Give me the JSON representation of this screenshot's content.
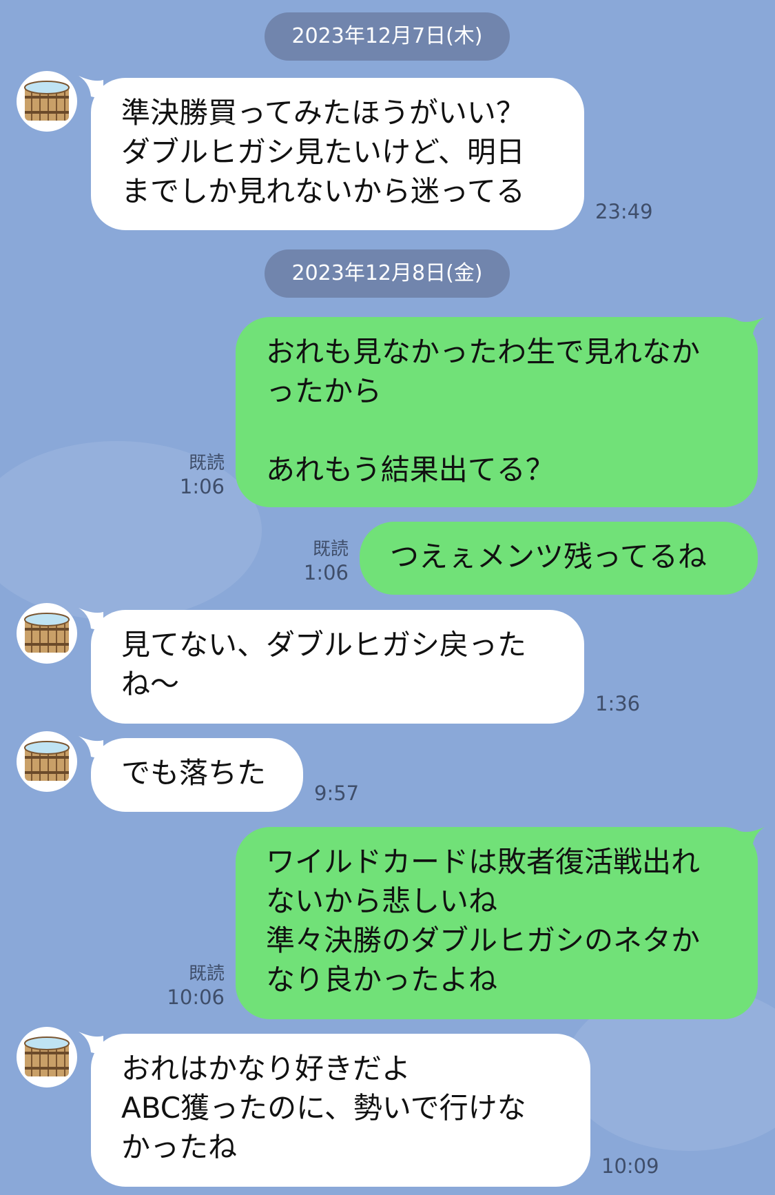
{
  "dates": [
    "2023年12月7日(木)",
    "2023年12月8日(金)"
  ],
  "messages": [
    {
      "side": "in",
      "text": "準決勝買ってみたほうがいい？\nダブルヒガシ見たいけど、明日\nまでしか見れないから迷ってる",
      "time": "23:49"
    },
    {
      "side": "out",
      "text": "おれも見なかったわ生で見れなか\nったから\n\nあれもう結果出てる？",
      "read": "既読",
      "time": "1:06"
    },
    {
      "side": "out",
      "text": "つえぇメンツ残ってるね",
      "read": "既読",
      "time": "1:06"
    },
    {
      "side": "in",
      "text": "見てない、ダブルヒガシ戻った\nね〜",
      "time": "1:36"
    },
    {
      "side": "in",
      "text": "でも落ちた",
      "time": "9:57"
    },
    {
      "side": "out",
      "text": "ワイルドカードは敗者復活戦出れ\nないから悲しいね\n準々決勝のダブルヒガシのネタか\nなり良かったよね",
      "read": "既読",
      "time": "10:06"
    },
    {
      "side": "in",
      "text": "おれはかなり好きだよ\nABC獲ったのに、勢いで行けな\nかったね",
      "time": "10:09"
    }
  ],
  "avatar_icon": "wooden-tub-icon",
  "colors": {
    "background": "#8aa8d8",
    "incoming": "#ffffff",
    "outgoing": "#71e178",
    "date_pill": "#7185ad"
  }
}
